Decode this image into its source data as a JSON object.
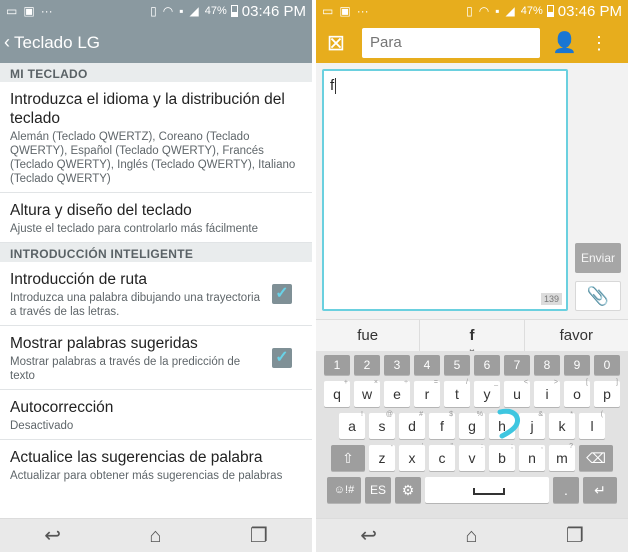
{
  "status": {
    "battery": "47%",
    "time": "03:46 PM"
  },
  "left": {
    "header": {
      "title": "Teclado LG"
    },
    "sections": [
      {
        "label": "MI TECLADO"
      },
      {
        "label": "INTRODUCCIÓN INTELIGENTE"
      }
    ],
    "items": [
      {
        "title": "Introduzca el idioma y la distribución del teclado",
        "subtitle": "Alemán (Teclado QWERTZ), Coreano (Teclado QWERTY), Español (Teclado QWERTY), Francés (Teclado QWERTY), Inglés (Teclado QWERTY), Italiano (Teclado QWERTY)"
      },
      {
        "title": "Altura y diseño del teclado",
        "subtitle": "Ajuste el teclado para controlarlo más fácilmente"
      },
      {
        "title": "Introducción de ruta",
        "subtitle": "Introduzca una palabra dibujando una trayectoria a través de las letras.",
        "checked": true
      },
      {
        "title": "Mostrar palabras sugeridas",
        "subtitle": "Mostrar palabras a través de la predicción de texto",
        "checked": true
      },
      {
        "title": "Autocorrección",
        "subtitle": "Desactivado"
      },
      {
        "title": "Actualice las sugerencias de palabra",
        "subtitle": "Actualizar para obtener más sugerencias de palabras"
      }
    ]
  },
  "right": {
    "to_placeholder": "Para",
    "message_text": "f",
    "counter": "139",
    "send_label": "Enviar",
    "suggestions": [
      "fue",
      "f",
      "favor"
    ],
    "num_row": [
      "1",
      "2",
      "3",
      "4",
      "5",
      "6",
      "7",
      "8",
      "9",
      "0"
    ],
    "row1": [
      {
        "k": "q",
        "s": "+"
      },
      {
        "k": "w",
        "s": "×"
      },
      {
        "k": "e",
        "s": "÷"
      },
      {
        "k": "r",
        "s": "="
      },
      {
        "k": "t",
        "s": "/"
      },
      {
        "k": "y",
        "s": "_"
      },
      {
        "k": "u",
        "s": "<"
      },
      {
        "k": "i",
        "s": ">"
      },
      {
        "k": "o",
        "s": "["
      },
      {
        "k": "p",
        "s": "]"
      }
    ],
    "row2": [
      {
        "k": "a",
        "s": "!"
      },
      {
        "k": "s",
        "s": "@"
      },
      {
        "k": "d",
        "s": "#"
      },
      {
        "k": "f",
        "s": "$"
      },
      {
        "k": "g",
        "s": "%"
      },
      {
        "k": "h",
        "s": "^"
      },
      {
        "k": "j",
        "s": "&"
      },
      {
        "k": "k",
        "s": "*"
      },
      {
        "k": "l",
        "s": "("
      }
    ],
    "row3": [
      {
        "k": "z",
        "s": "-"
      },
      {
        "k": "x",
        "s": "'"
      },
      {
        "k": "c",
        "s": "\""
      },
      {
        "k": "v",
        "s": ":"
      },
      {
        "k": "b",
        "s": ";"
      },
      {
        "k": "n",
        "s": ","
      },
      {
        "k": "m",
        "s": "?"
      }
    ],
    "sym_key": "☺!#",
    "lang_key": "ES",
    "period_key": "."
  },
  "colors": {
    "left_accent": "#8a99a0",
    "right_accent": "#e7ad1d",
    "check": "#69d2e7",
    "swipe": "#3ec6e0"
  },
  "icons": [
    "back-icon",
    "checkbox-icon",
    "contacts-icon",
    "overflow-icon",
    "attach-icon",
    "shift-icon",
    "backspace-icon",
    "gear-icon",
    "enter-icon",
    "nav-back-icon",
    "nav-home-icon",
    "nav-recent-icon"
  ]
}
